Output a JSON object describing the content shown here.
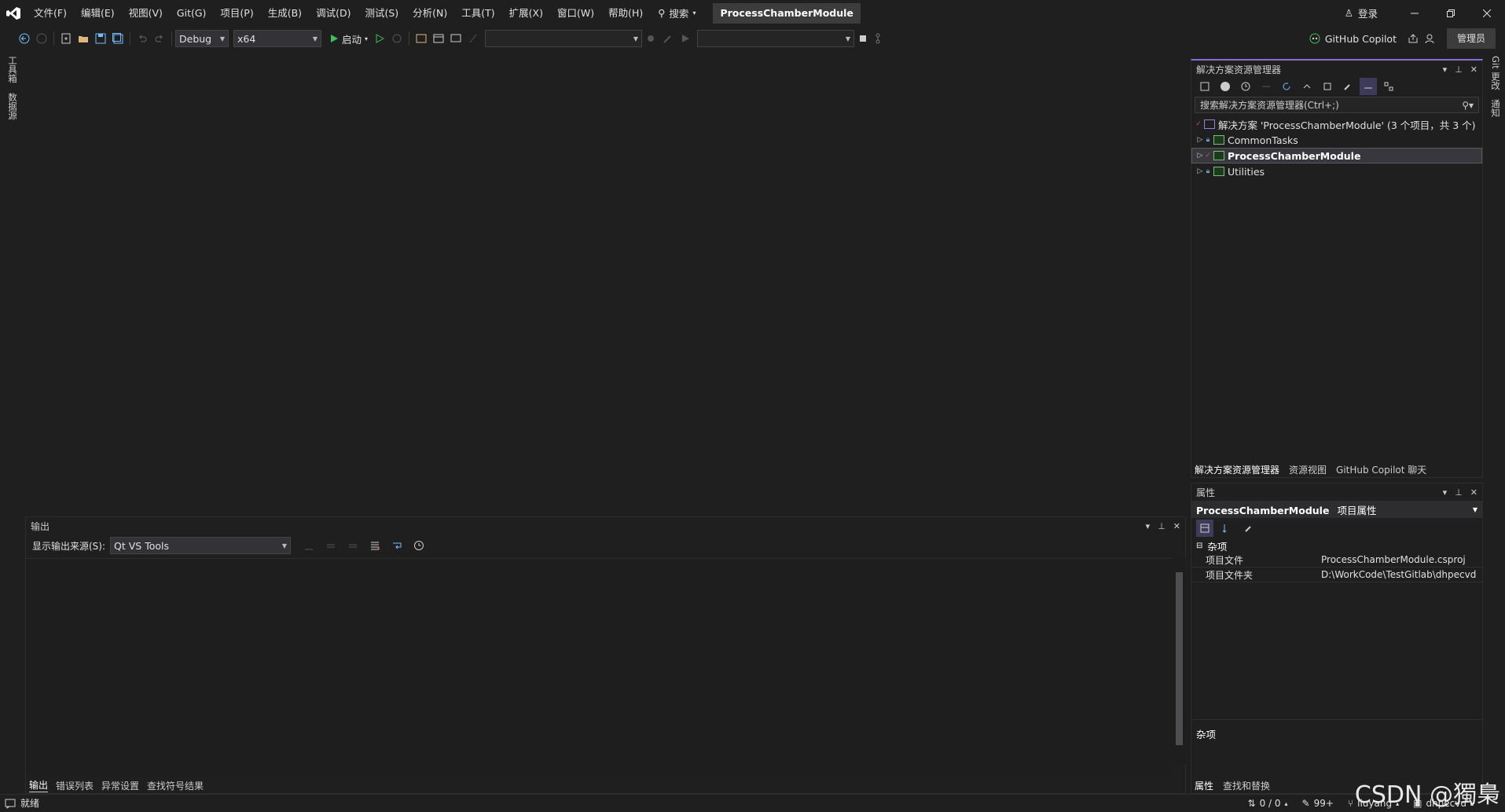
{
  "menu": [
    "文件(F)",
    "编辑(E)",
    "视图(V)",
    "Git(G)",
    "项目(P)",
    "生成(B)",
    "调试(D)",
    "测试(S)",
    "分析(N)",
    "工具(T)",
    "扩展(X)",
    "窗口(W)",
    "帮助(H)"
  ],
  "search_label": "搜索",
  "solution_title": "ProcessChamberModule",
  "login_label": "登录",
  "toolbar": {
    "config": "Debug",
    "platform": "x64",
    "start_label": "启动",
    "copilot_label": "GitHub Copilot",
    "admin_label": "管理员"
  },
  "left_tabs": [
    "工具箱",
    "数据源"
  ],
  "right_tabs": [
    "Git 更改",
    "通知"
  ],
  "solution_explorer": {
    "title": "解决方案资源管理器",
    "search_placeholder": "搜索解决方案资源管理器(Ctrl+;)",
    "solution_node": "解决方案 'ProcessChamberModule' (3 个项目，共 3 个)",
    "projects": [
      "CommonTasks",
      "ProcessChamberModule",
      "Utilities"
    ],
    "tabs": [
      "解决方案资源管理器",
      "资源视图",
      "GitHub Copilot 聊天"
    ]
  },
  "properties": {
    "title": "属性",
    "object_name": "ProcessChamberModule",
    "object_type": "项目属性",
    "category": "杂项",
    "rows": [
      {
        "key": "项目文件",
        "value": "ProcessChamberModule.csproj"
      },
      {
        "key": "项目文件夹",
        "value": "D:\\WorkCode\\TestGitlab\\dhpecvd"
      }
    ],
    "desc_title": "杂项",
    "tabs": [
      "属性",
      "查找和替换"
    ]
  },
  "output": {
    "title": "输出",
    "source_label": "显示输出来源(S):",
    "source_value": "Qt VS Tools",
    "tabs": [
      "输出",
      "错误列表",
      "异常设置",
      "查找符号结果"
    ]
  },
  "status": {
    "ready": "就绪",
    "line_info": "0 / 0",
    "pending": "99+",
    "user": "liuyang",
    "repo": "dhpecvd"
  },
  "watermark": "CSDN @獨梟",
  "colors": {
    "accent_purple": "#8a6bd6",
    "start_green": "#3fbf5a",
    "icon_blue": "#75beff"
  }
}
